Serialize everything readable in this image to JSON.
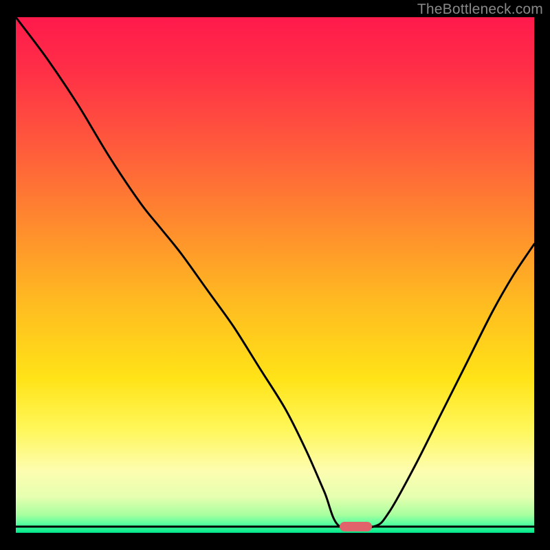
{
  "watermark": "TheBottleneck.com",
  "marker": {
    "x": 0.625,
    "width_frac": 0.062
  },
  "gradient_stops": [
    {
      "offset": 0.0,
      "color": "#ff1a4c"
    },
    {
      "offset": 0.1,
      "color": "#ff2e47"
    },
    {
      "offset": 0.25,
      "color": "#ff5a3c"
    },
    {
      "offset": 0.4,
      "color": "#ff8a2e"
    },
    {
      "offset": 0.55,
      "color": "#ffba21"
    },
    {
      "offset": 0.7,
      "color": "#ffe317"
    },
    {
      "offset": 0.8,
      "color": "#fff75a"
    },
    {
      "offset": 0.88,
      "color": "#fdfdb0"
    },
    {
      "offset": 0.93,
      "color": "#e6ffb0"
    },
    {
      "offset": 0.965,
      "color": "#a8ff9e"
    },
    {
      "offset": 0.985,
      "color": "#4dffa0"
    },
    {
      "offset": 1.0,
      "color": "#00e68a"
    }
  ],
  "chart_data": {
    "type": "line",
    "title": "",
    "xlabel": "",
    "ylabel": "",
    "xlim": [
      0,
      1
    ],
    "ylim": [
      0,
      1
    ],
    "series": [
      {
        "name": "bottleneck-curve",
        "x": [
          0.0,
          0.06,
          0.12,
          0.18,
          0.24,
          0.28,
          0.32,
          0.37,
          0.42,
          0.47,
          0.52,
          0.56,
          0.595,
          0.625,
          0.69,
          0.72,
          0.77,
          0.82,
          0.87,
          0.92,
          0.96,
          1.0
        ],
        "values": [
          1.0,
          0.92,
          0.83,
          0.73,
          0.64,
          0.59,
          0.54,
          0.47,
          0.4,
          0.32,
          0.24,
          0.16,
          0.08,
          0.012,
          0.012,
          0.04,
          0.13,
          0.23,
          0.33,
          0.43,
          0.5,
          0.56
        ]
      }
    ],
    "baseline_y": 0.012,
    "optimum_x": 0.656
  }
}
